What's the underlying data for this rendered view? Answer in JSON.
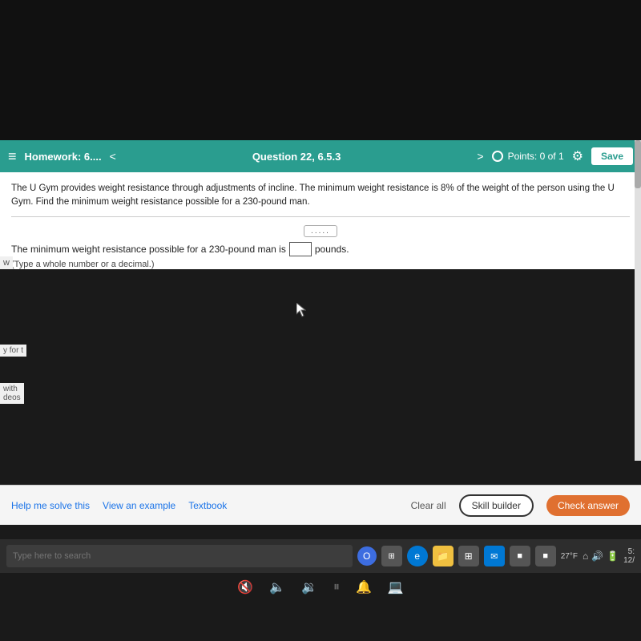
{
  "header": {
    "menu_icon": "≡",
    "homework_label": "Homework: 6....",
    "nav_prev": "<",
    "question_label": "Question 22, 6.5.3",
    "nav_next": ">",
    "points_label": "Points: 0 of 1",
    "settings_icon": "⚙",
    "save_label": "Save"
  },
  "problem": {
    "text": "The U Gym provides weight resistance through adjustments of incline. The minimum weight resistance is 8% of the weight of the person using the U Gym. Find the minimum weight resistance possible for a 230-pound man.",
    "dots": ".....",
    "answer_prefix": "The minimum weight resistance possible for a 230-pound man is",
    "answer_suffix": "pounds.",
    "hint": "(Type a whole number or a decimal.)"
  },
  "side_labels": {
    "w": "w",
    "for_t": "y for t",
    "with": "with\ndeos"
  },
  "toolbar": {
    "help_label": "Help me solve this",
    "example_label": "View an example",
    "textbook_label": "Textbook",
    "clear_label": "Clear all",
    "skill_label": "Skill builder",
    "check_label": "Check answer"
  },
  "taskbar": {
    "search_placeholder": "Type here to search",
    "weather": "27°F",
    "time": "5:\n12/"
  }
}
